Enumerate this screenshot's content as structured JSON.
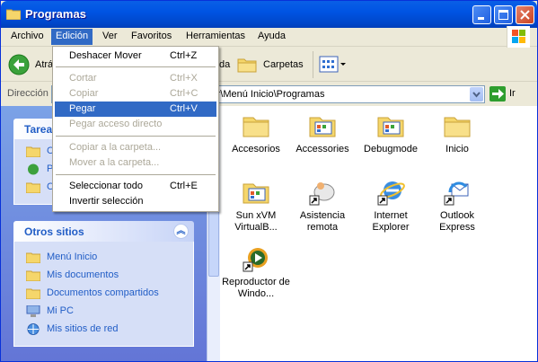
{
  "window": {
    "title": "Programas",
    "icon": "folder-icon"
  },
  "menubar": {
    "items": [
      "Archivo",
      "Edición",
      "Ver",
      "Favoritos",
      "Herramientas",
      "Ayuda"
    ],
    "active": "Edición"
  },
  "toolbar": {
    "back_label": "Atrás",
    "search_fragment": "da",
    "folders_label": "Carpetas"
  },
  "address": {
    "label": "Dirección",
    "value": "sor\\Menú Inicio\\Programas",
    "go_label": "Ir"
  },
  "edit_menu": {
    "items": [
      {
        "label": "Deshacer Mover",
        "shortcut": "Ctrl+Z",
        "disabled": false
      },
      {
        "label": "Cortar",
        "shortcut": "Ctrl+X",
        "disabled": true
      },
      {
        "label": "Copiar",
        "shortcut": "Ctrl+C",
        "disabled": true
      },
      {
        "label": "Pegar",
        "shortcut": "Ctrl+V",
        "disabled": false,
        "highlighted": true
      },
      {
        "label": "Pegar acceso directo",
        "shortcut": "",
        "disabled": true
      },
      {
        "label": "Copiar a la carpeta...",
        "shortcut": "",
        "disabled": true
      },
      {
        "label": "Mover a la carpeta...",
        "shortcut": "",
        "disabled": true
      },
      {
        "label": "Seleccionar todo",
        "shortcut": "Ctrl+E",
        "disabled": false
      },
      {
        "label": "Invertir selección",
        "shortcut": "",
        "disabled": false
      }
    ]
  },
  "tasks_panel": {
    "title_fragment": "Tarea",
    "link_fragments": [
      "C",
      "P",
      "C"
    ]
  },
  "other_places": {
    "title": "Otros sitios",
    "links": [
      {
        "label": "Menú Inicio",
        "icon": "folder-icon"
      },
      {
        "label": "Mis documentos",
        "icon": "folder-icon"
      },
      {
        "label": "Documentos compartidos",
        "icon": "folder-icon"
      },
      {
        "label": "Mi PC",
        "icon": "computer-icon"
      },
      {
        "label": "Mis sitios de red",
        "icon": "network-icon"
      }
    ]
  },
  "files": [
    {
      "label": "Accesorios",
      "icon": "folder-icon"
    },
    {
      "label": "Accessories",
      "icon": "program-folder-icon"
    },
    {
      "label": "Debugmode",
      "icon": "program-folder-icon"
    },
    {
      "label": "Inicio",
      "icon": "folder-icon"
    },
    {
      "label": "Sun xVM VirtualB...",
      "icon": "program-folder-icon"
    },
    {
      "label": "Asistencia remota",
      "icon": "remote-assistance-icon"
    },
    {
      "label": "Internet Explorer",
      "icon": "internet-explorer-icon"
    },
    {
      "label": "Outlook Express",
      "icon": "outlook-express-icon"
    },
    {
      "label": "Reproductor de Windo...",
      "icon": "media-player-icon"
    }
  ],
  "colors": {
    "titlebar": "#0054E3",
    "highlight": "#316AC5",
    "panel_text": "#215DC6",
    "pane_bg": "#7BA2E7"
  }
}
